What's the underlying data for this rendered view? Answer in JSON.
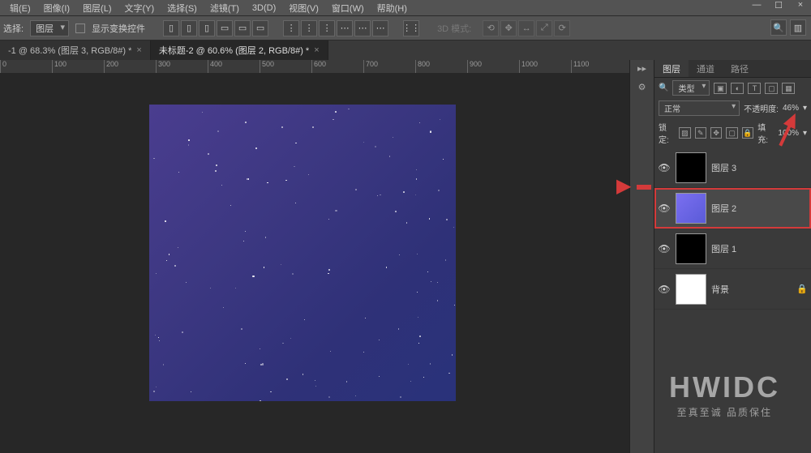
{
  "menu": {
    "items": [
      "辑(E)",
      "图像(I)",
      "图层(L)",
      "文字(Y)",
      "选择(S)",
      "滤镜(T)",
      "3D(D)",
      "视图(V)",
      "窗口(W)",
      "帮助(H)"
    ]
  },
  "options": {
    "select_label": "选择:",
    "layer_dropdown": "图层",
    "show_transform": "显示变换控件",
    "mode_3d": "3D 模式:"
  },
  "tabs": [
    {
      "label": "-1 @ 68.3% (图层 3, RGB/8#) *",
      "active": false
    },
    {
      "label": "未标题-2 @ 60.6% (图层 2, RGB/8#) *",
      "active": true
    }
  ],
  "ruler": [
    "0",
    "100",
    "200",
    "300",
    "400",
    "500",
    "600",
    "700",
    "800",
    "900",
    "1000",
    "1100"
  ],
  "panel": {
    "tabs": [
      "图层",
      "通道",
      "路径"
    ],
    "type_label": "类型",
    "blend_mode": "正常",
    "opacity_label": "不透明度:",
    "opacity_value": "46%",
    "lock_label": "锁定:",
    "fill_label": "填充:",
    "fill_value": "100%"
  },
  "layers": [
    {
      "name": "图层 3",
      "thumb": "black",
      "visible": true,
      "selected": false,
      "locked": false
    },
    {
      "name": "图层 2",
      "thumb": "grad",
      "visible": true,
      "selected": true,
      "locked": false
    },
    {
      "name": "图层 1",
      "thumb": "black",
      "visible": true,
      "selected": false,
      "locked": false
    },
    {
      "name": "背景",
      "thumb": "white",
      "visible": true,
      "selected": false,
      "locked": true
    }
  ],
  "watermark": {
    "main": "HWIDC",
    "sub": "至真至诚  品质保住"
  }
}
